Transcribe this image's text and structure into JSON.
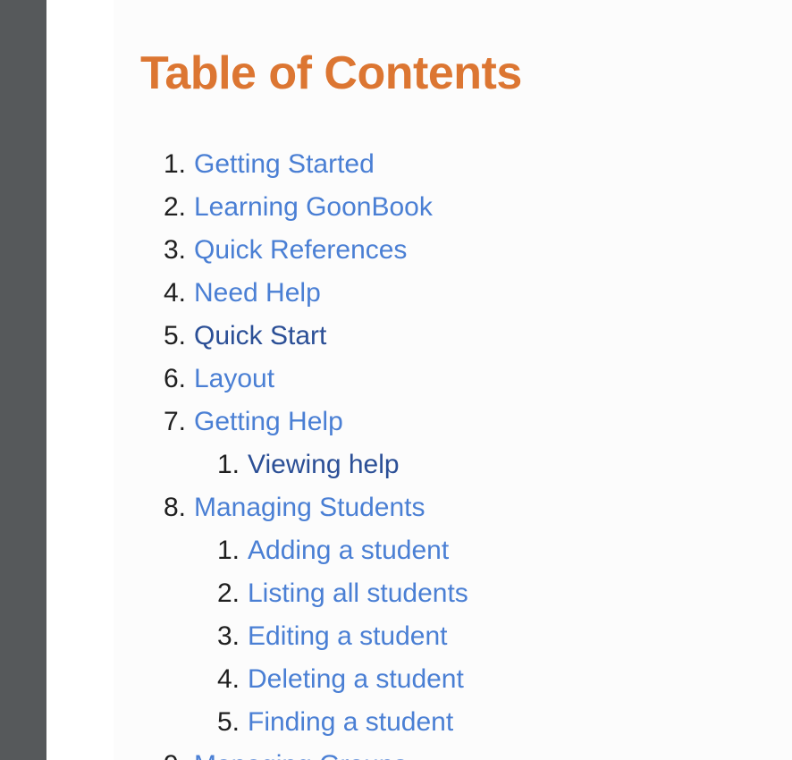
{
  "title": "Table of Contents",
  "toc": [
    {
      "label": "Getting Started"
    },
    {
      "label": "Learning GoonBook"
    },
    {
      "label": "Quick References"
    },
    {
      "label": "Need Help"
    },
    {
      "label": "Quick Start",
      "visited": true
    },
    {
      "label": "Layout"
    },
    {
      "label": "Getting Help",
      "children": [
        {
          "label": "Viewing help",
          "visited": true
        }
      ]
    },
    {
      "label": "Managing Students",
      "children": [
        {
          "label": "Adding a student"
        },
        {
          "label": "Listing all students"
        },
        {
          "label": "Editing a student"
        },
        {
          "label": "Deleting a student"
        },
        {
          "label": "Finding a student"
        }
      ]
    },
    {
      "label": "Managing Groups"
    }
  ],
  "colors": {
    "title": "#dc7632",
    "link": "#4a7fd4",
    "visited_link": "#2b4f96",
    "sidebar": "#56595b",
    "background": "#fcfcfc"
  }
}
